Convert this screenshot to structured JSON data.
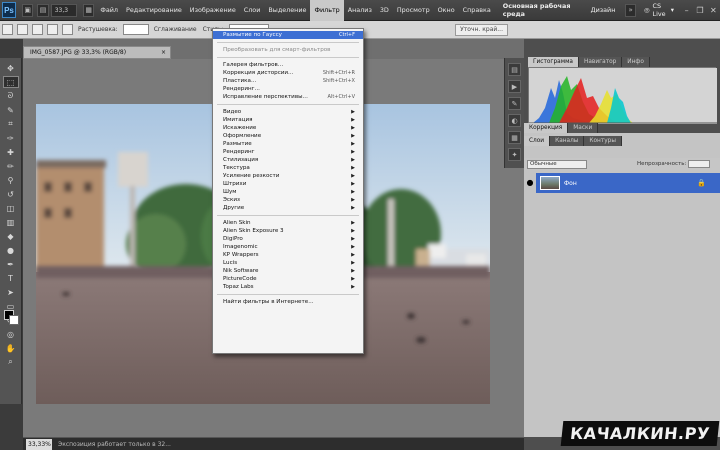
{
  "app": {
    "logo": "Ps",
    "menu": [
      "Файл",
      "Редактирование",
      "Изображение",
      "Слои",
      "Выделение",
      "Фильтр",
      "Анализ",
      "3D",
      "Просмотр",
      "Окно",
      "Справка"
    ],
    "active_menu_index": 5,
    "zoom": "33,3",
    "workspace": "Основная рабочая среда",
    "workspace_alt": "Дизайн",
    "cs_live": "CS Live"
  },
  "options_bar": {
    "feather_label": "Растушевка:",
    "feather_value": "0 пикс",
    "antialias_label": "Сглаживание",
    "style_label": "Стиль:",
    "refine_button": "Уточн. край..."
  },
  "document": {
    "tab_title": "IMG_0587.JPG @ 33,3% (RGB/8)",
    "tab_close": "×",
    "status_zoom": "33,33%",
    "status_text": "Экспозиция работает только в 32..."
  },
  "filter_menu": {
    "items": [
      {
        "label": "Размытие по Гауссу",
        "shortcut": "Ctrl+F",
        "highlighted": true
      },
      {
        "sep": true
      },
      {
        "label": "Преобразовать для смарт-фильтров",
        "disabled": true
      },
      {
        "sep": true
      },
      {
        "label": "Галерея фильтров..."
      },
      {
        "label": "Коррекция дисторсии...",
        "shortcut": "Shift+Ctrl+R"
      },
      {
        "label": "Пластика...",
        "shortcut": "Shift+Ctrl+X"
      },
      {
        "label": "Рендеринг..."
      },
      {
        "label": "Исправление перспективы...",
        "shortcut": "Alt+Ctrl+V"
      },
      {
        "sep": true
      },
      {
        "label": "Видео",
        "sub": true
      },
      {
        "label": "Имитация",
        "sub": true
      },
      {
        "label": "Искажение",
        "sub": true
      },
      {
        "label": "Оформление",
        "sub": true
      },
      {
        "label": "Размытие",
        "sub": true
      },
      {
        "label": "Рендеринг",
        "sub": true
      },
      {
        "label": "Стилизация",
        "sub": true
      },
      {
        "label": "Текстура",
        "sub": true
      },
      {
        "label": "Усиление резкости",
        "sub": true
      },
      {
        "label": "Штрихи",
        "sub": true
      },
      {
        "label": "Шум",
        "sub": true
      },
      {
        "label": "Эскиз",
        "sub": true
      },
      {
        "label": "Другие",
        "sub": true
      },
      {
        "sep": true
      },
      {
        "label": "Alien Skin",
        "sub": true
      },
      {
        "label": "Alien Skin Exposure 3",
        "sub": true
      },
      {
        "label": "DigiPro",
        "sub": true
      },
      {
        "label": "Imagenomic",
        "sub": true
      },
      {
        "label": "KP Wrappers",
        "sub": true
      },
      {
        "label": "Lucis",
        "sub": true
      },
      {
        "label": "Nik Software",
        "sub": true
      },
      {
        "label": "PictureCode",
        "sub": true
      },
      {
        "label": "Topaz Labs",
        "sub": true
      },
      {
        "sep": true
      },
      {
        "label": "Найти фильтры в Интернете..."
      }
    ]
  },
  "panels": {
    "top_tabs": [
      "Гистограмма",
      "Навигатор",
      "Инфо"
    ],
    "mid_tabs": [
      "Коррекция",
      "Маски"
    ],
    "layer_tabs": [
      "Слои",
      "Каналы",
      "Контуры"
    ],
    "blend_mode": "Обычные",
    "opacity_label": "Непрозрачность:",
    "fill_label": "Заливка:",
    "layer_name": "Фон"
  },
  "watermark": "КАЧАЛКИН.РУ",
  "colors": {
    "highlight": "#3d6fd3",
    "menu_bg": "#f4f4f4",
    "panel_bg": "#4e4e4e"
  }
}
